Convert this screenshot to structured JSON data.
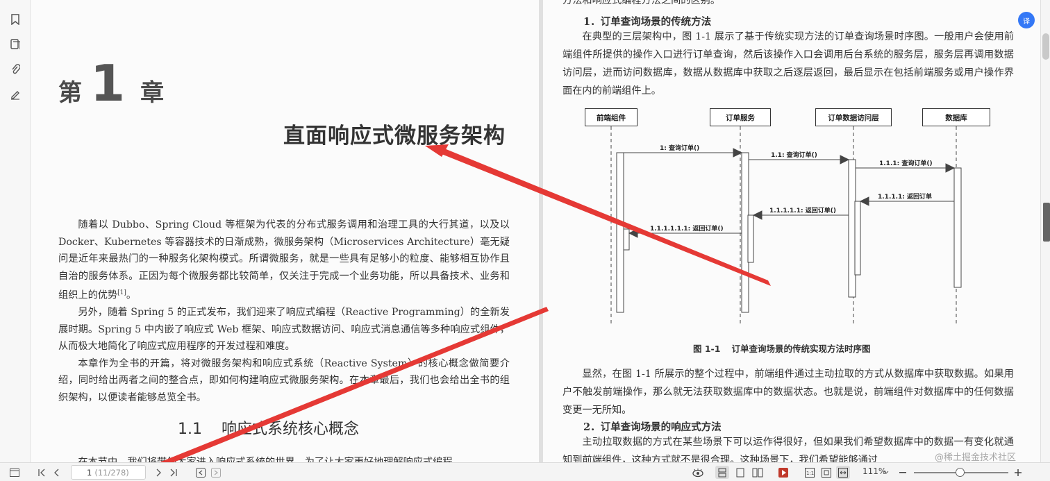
{
  "toolbar": {
    "left_icons": [
      "bookmark-icon",
      "pages-icon",
      "attachment-icon",
      "signature-icon"
    ]
  },
  "page_left": {
    "chapter_prefix": "第",
    "chapter_num": "1",
    "chapter_suffix": "章",
    "chapter_title": "直面响应式微服务架构",
    "para1": "随着以 Dubbo、Spring Cloud 等框架为代表的分布式服务调用和治理工具的大行其道，以及以 Docker、Kubernetes 等容器技术的日渐成熟，微服务架构（Microservices Architecture）毫无疑问是近年来最热门的一种服务化架构模式。所谓微服务，就是一些具有足够小的粒度、能够相互协作且自治的服务体系。正因为每个微服务都比较简单，仅关注于完成一个业务功能，所以具备技术、业务和组织上的优势",
    "para1_ref": "[1]",
    "para1_end": "。",
    "para2": "另外，随着 Spring 5 的正式发布，我们迎来了响应式编程（Reactive Programming）的全新发展时期。Spring 5 中内嵌了响应式 Web 框架、响应式数据访问、响应式消息通信等多种响应式组件，从而极大地简化了响应式应用程序的开发过程和难度。",
    "para3": "本章作为全书的开篇，将对微服务架构和响应式系统（Reactive System）的核心概念做简要介绍，同时给出两者之间的整合点，即如何构建响应式微服务架构。在本章最后，我们也会给出全书的组织架构，以便读者能够总览全书。",
    "section_num": "1.1",
    "section_title": "响应式系统核心概念",
    "para4": "在本节中，我们将带领大家进入响应式系统的世界。为了让大家更好地理解响应式编程"
  },
  "page_right": {
    "top_cut": "方法和响应式编程方法之间的区别。",
    "h1": "1．订单查询场景的传统方法",
    "p1": "在典型的三层架构中，图 1-1 展示了基于传统实现方法的订单查询场景时序图。一般用户会使用前端组件所提供的操作入口进行订单查询，然后该操作入口会调用后台系统的服务层，服务层再调用数据访问层，进而访问数据库，数据从数据库中获取之后逐层返回，最后显示在包括前端服务或用户操作界面在内的前端组件上。",
    "figure": {
      "lifelines": [
        "前端组件",
        "订单服务",
        "订单数据访问层",
        "数据库"
      ],
      "messages": [
        "1: 查询订单()",
        "1.1: 查询订单()",
        "1.1.1: 查询订单()",
        "1.1.1.1: 返回订单",
        "1.1.1.1.1: 返回订单()",
        "1.1.1.1.1.1: 返回订单()"
      ],
      "caption_num": "图 1-1",
      "caption": "订单查询场景的传统实现方法时序图"
    },
    "p2": "显然，在图 1-1 所展示的整个过程中，前端组件通过主动拉取的方式从数据库中获取数据。如果用户不触发前端操作，那么就无法获取数据库中的数据状态。也就是说，前端组件对数据库中的任何数据变更一无所知。",
    "h2": "2．订单查询场景的响应式方法",
    "p3": "主动拉取数据的方式在某些场景下可以运作得很好，但如果我们希望数据库中的数据一有变化就通知到前端组件，这种方式就不是很合理。这种场景下，我们希望能够通过"
  },
  "float_button": "译",
  "statusbar": {
    "page_current": "1",
    "page_total": "(11/278)",
    "zoom": "111%",
    "watermark": "@稀土掘金技术社区"
  },
  "colors": {
    "accent": "#3478f6",
    "annotation": "#e53935"
  }
}
